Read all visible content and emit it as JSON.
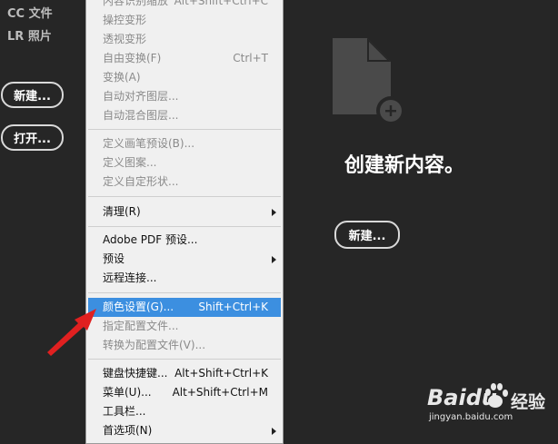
{
  "sidebar": {
    "items": [
      {
        "label": "CC 文件"
      },
      {
        "label": "LR 照片"
      }
    ],
    "new_button": "新建...",
    "open_button": "打开..."
  },
  "main": {
    "heading": "创建新内容。",
    "new_button": "新建..."
  },
  "menu": {
    "items": [
      {
        "label": "内容识别缩放",
        "shortcut": "Alt+Shift+Ctrl+C",
        "disabled": true
      },
      {
        "label": "操控变形",
        "disabled": true
      },
      {
        "label": "透视变形",
        "disabled": true
      },
      {
        "label": "自由变换(F)",
        "shortcut": "Ctrl+T",
        "disabled": true
      },
      {
        "label": "变换(A)",
        "disabled": true,
        "submenu": true
      },
      {
        "label": "自动对齐图层...",
        "disabled": true
      },
      {
        "label": "自动混合图层...",
        "disabled": true
      },
      {
        "label": "定义画笔预设(B)...",
        "disabled": true
      },
      {
        "label": "定义图案...",
        "disabled": true
      },
      {
        "label": "定义自定形状...",
        "disabled": true
      },
      {
        "label": "清理(R)",
        "disabled": false,
        "submenu": true
      },
      {
        "label": "Adobe PDF 预设...",
        "disabled": false
      },
      {
        "label": "预设",
        "disabled": false,
        "submenu": true
      },
      {
        "label": "远程连接...",
        "disabled": false
      },
      {
        "label": "颜色设置(G)...",
        "shortcut": "Shift+Ctrl+K",
        "disabled": false,
        "highlighted": true
      },
      {
        "label": "指定配置文件...",
        "disabled": true
      },
      {
        "label": "转换为配置文件(V)...",
        "disabled": true
      },
      {
        "label": "键盘快捷键...",
        "shortcut": "Alt+Shift+Ctrl+K",
        "disabled": false
      },
      {
        "label": "菜单(U)...",
        "shortcut": "Alt+Shift+Ctrl+M",
        "disabled": false
      },
      {
        "label": "工具栏...",
        "disabled": false
      },
      {
        "label": "首选项(N)",
        "disabled": false,
        "submenu": true
      }
    ]
  },
  "watermark": {
    "brand": "Baidu",
    "experience": "经验",
    "url": "jingyan.baidu.com"
  },
  "colors": {
    "background": "#262626",
    "menu_background": "#f0f0f0",
    "highlight": "#3c8fe0",
    "arrow": "#e02020"
  },
  "icons": [
    "new-document-icon",
    "plus-circle-icon",
    "submenu-arrow-icon",
    "annotation-arrow",
    "baidu-paw-icon"
  ]
}
